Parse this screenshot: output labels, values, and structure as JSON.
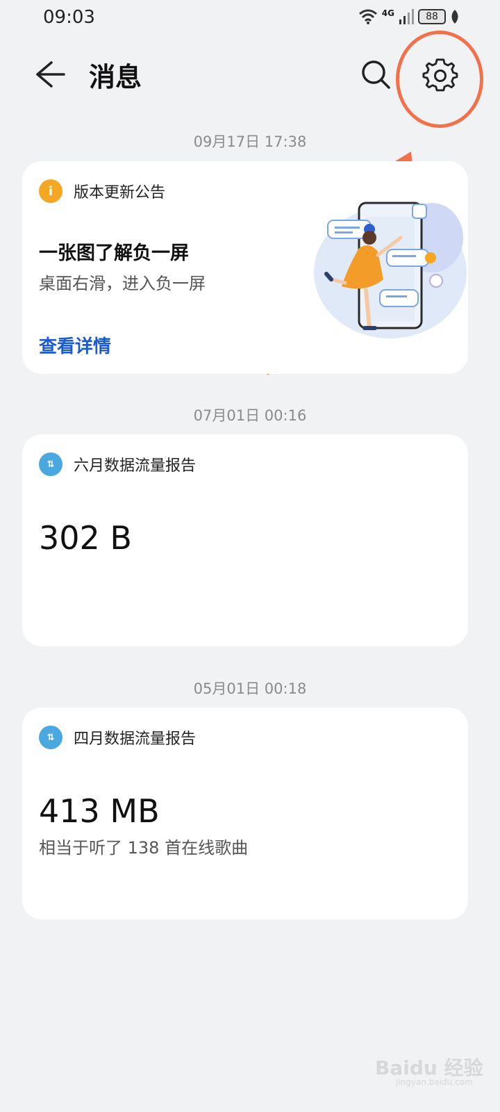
{
  "status_bar": {
    "time": "09:03",
    "network": "4G",
    "battery": "88",
    "icons": [
      "wifi-icon",
      "signal-icon",
      "battery-icon",
      "leaf-icon"
    ]
  },
  "header": {
    "title": "消息",
    "back_icon": "back-arrow-icon",
    "search_icon": "search-icon",
    "settings_icon": "gear-icon"
  },
  "messages": [
    {
      "timestamp": "09月17日 17:38",
      "source": "版本更新公告",
      "icon": "info-icon",
      "title": "一张图了解负一屏",
      "subtitle": "桌面右滑，进入负一屏",
      "link": "查看详情"
    },
    {
      "timestamp": "07月01日 00:16",
      "source": "六月数据流量报告",
      "icon": "data-traffic-icon",
      "value": "302 B"
    },
    {
      "timestamp": "05月01日 00:18",
      "source": "四月数据流量报告",
      "icon": "data-traffic-icon",
      "value": "413 MB",
      "subtitle": "相当于听了 138 首在线歌曲"
    }
  ],
  "watermark": {
    "text": "Baidu 经验",
    "sub": "jingyan.baidu.com"
  },
  "colors": {
    "background": "#f1f2f4",
    "link": "#1a5bd1",
    "annotation": "#f2704a"
  }
}
